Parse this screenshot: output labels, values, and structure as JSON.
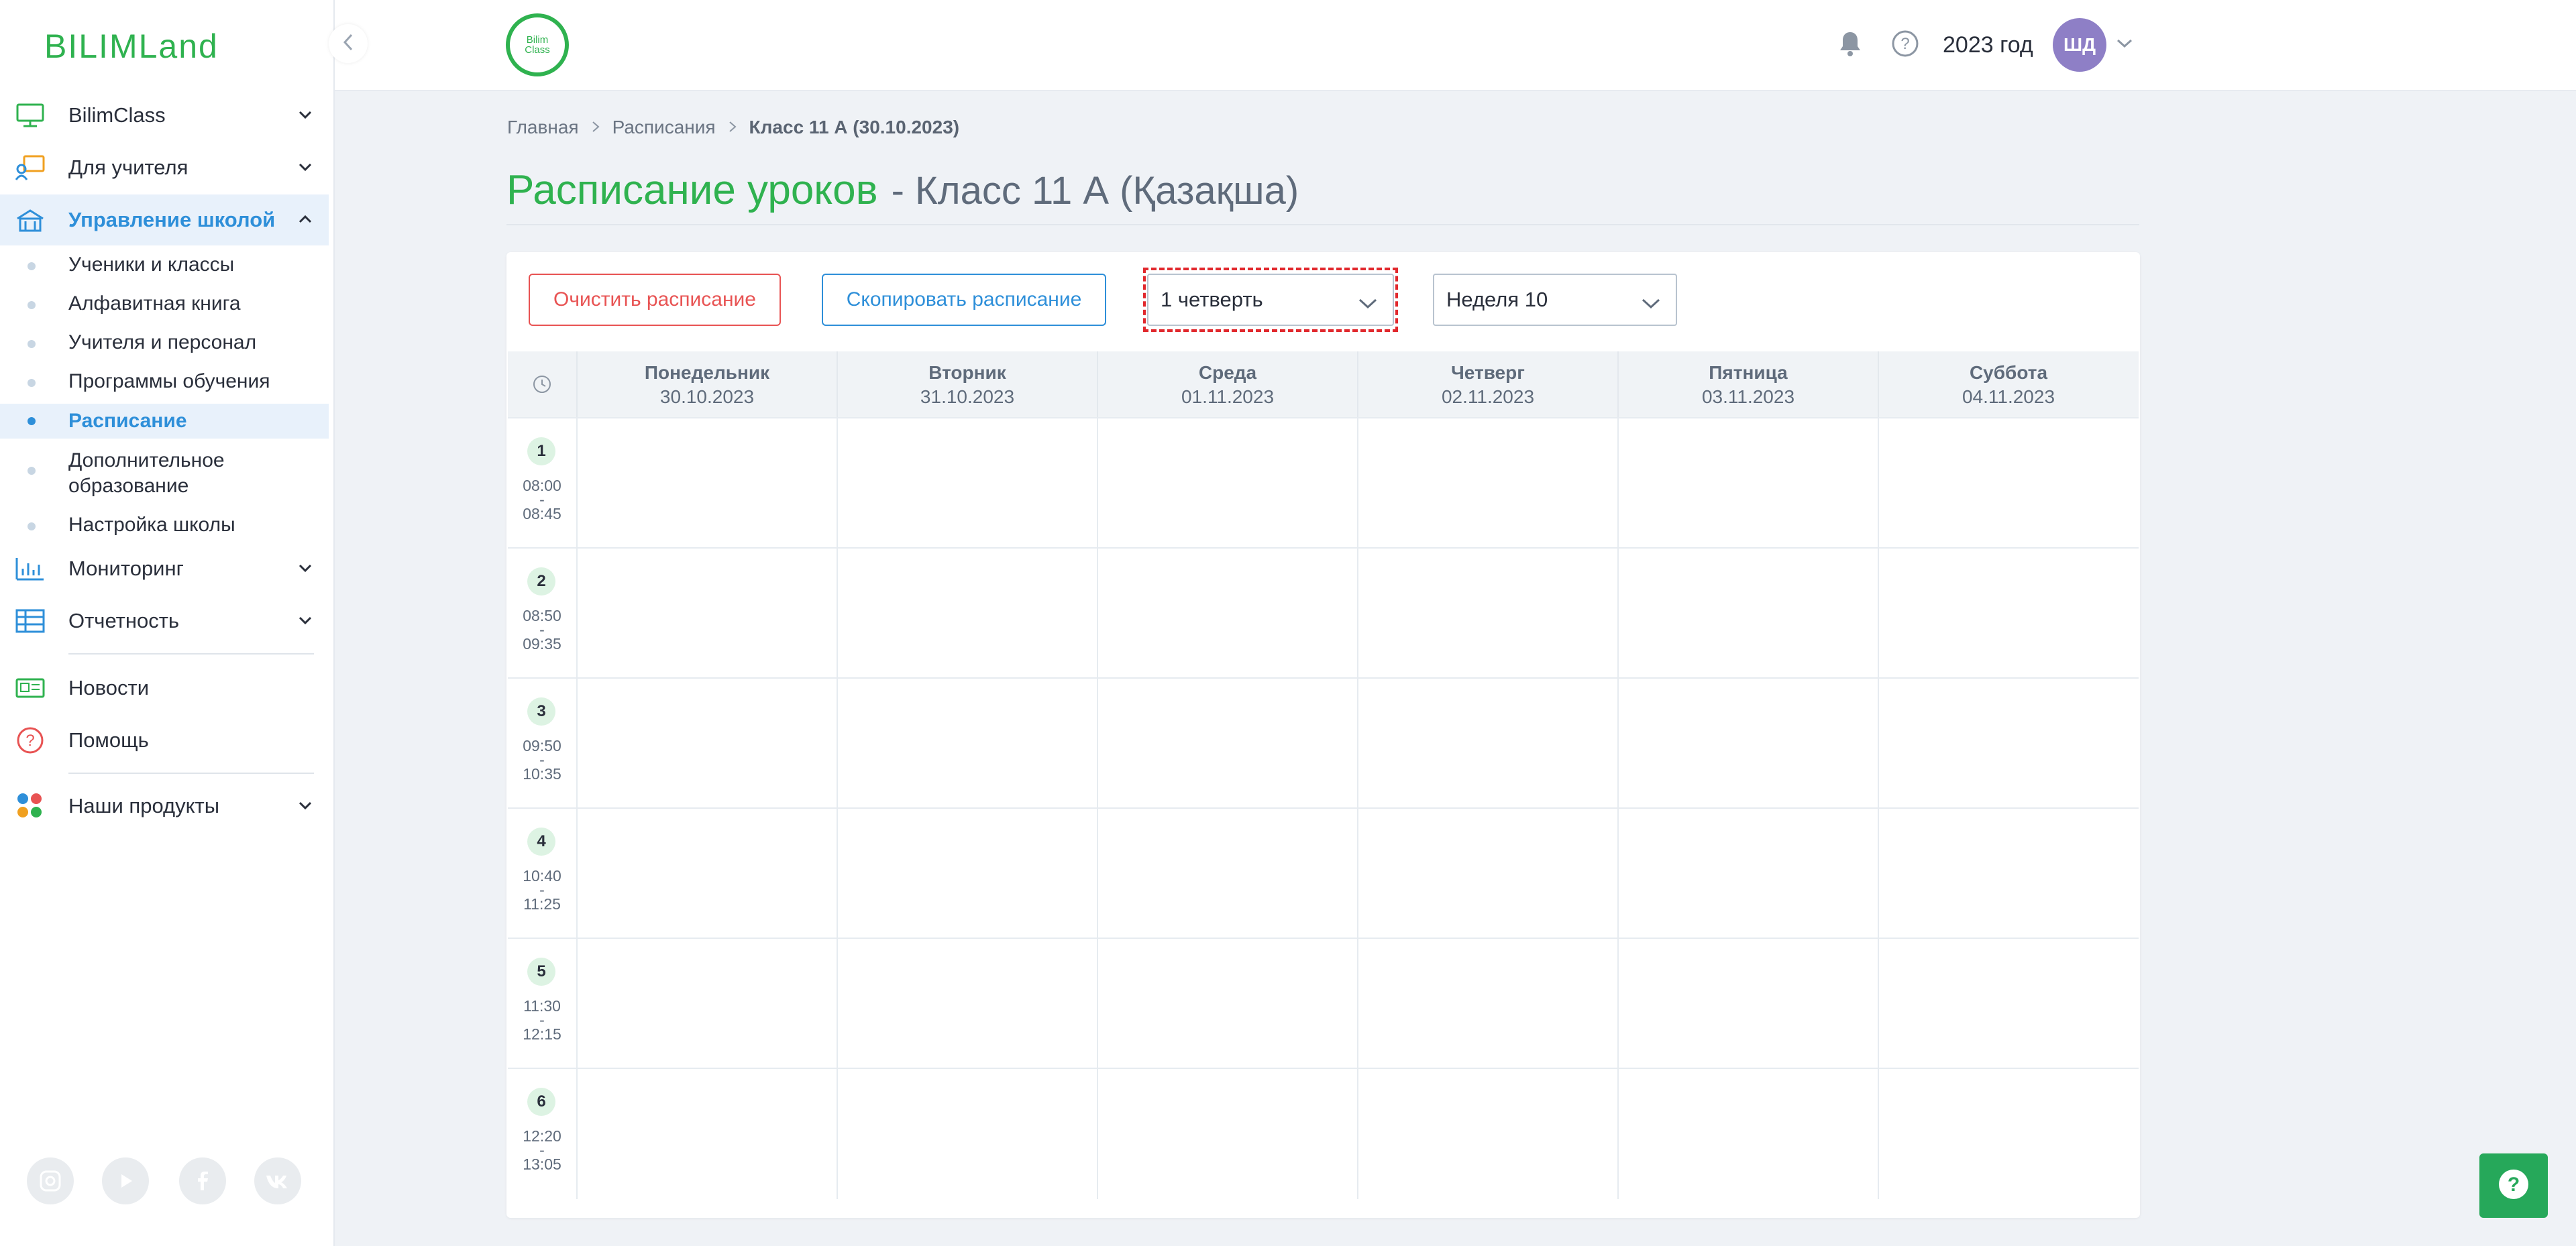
{
  "brand": {
    "logo": "BILIMLand",
    "class_logo_line1": "Bilim",
    "class_logo_line2": "Class"
  },
  "header": {
    "year": "2023 год",
    "avatar_initials": "ШД"
  },
  "sidebar": {
    "items": [
      {
        "label": "BilimClass",
        "icon": "monitor-icon"
      },
      {
        "label": "Для учителя",
        "icon": "teacher-icon"
      },
      {
        "label": "Управление школой",
        "icon": "school-icon"
      },
      {
        "label": "Мониторинг",
        "icon": "chart-icon"
      },
      {
        "label": "Отчетность",
        "icon": "table-icon"
      },
      {
        "label": "Новости",
        "icon": "news-icon"
      },
      {
        "label": "Помощь",
        "icon": "help-circle-icon"
      },
      {
        "label": "Наши продукты",
        "icon": "products-icon"
      }
    ],
    "submenu": [
      "Ученики и классы",
      "Алфавитная книга",
      "Учителя и персонал",
      "Программы обучения",
      "Расписание",
      "Дополнительное образование",
      "Настройка школы"
    ],
    "active_item": "Управление школой",
    "active_subitem": "Расписание",
    "social": [
      "instagram-icon",
      "youtube-icon",
      "facebook-icon",
      "vk-icon"
    ]
  },
  "breadcrumb": {
    "home": "Главная",
    "schedules": "Расписания",
    "current": "Класс 11 А (30.10.2023)"
  },
  "page": {
    "title": "Расписание уроков",
    "subtitle": "- Класс 11 А (Қазақша)"
  },
  "toolbar": {
    "clear_label": "Очистить расписание",
    "copy_label": "Скопировать расписание",
    "quarter_value": "1 четверть",
    "week_value": "Неделя 10"
  },
  "schedule": {
    "days": [
      {
        "name": "Понедельник",
        "date": "30.10.2023"
      },
      {
        "name": "Вторник",
        "date": "31.10.2023"
      },
      {
        "name": "Среда",
        "date": "01.11.2023"
      },
      {
        "name": "Четверг",
        "date": "02.11.2023"
      },
      {
        "name": "Пятница",
        "date": "03.11.2023"
      },
      {
        "name": "Суббота",
        "date": "04.11.2023"
      }
    ],
    "lessons": [
      {
        "num": "1",
        "start": "08:00",
        "end": "08:45"
      },
      {
        "num": "2",
        "start": "08:50",
        "end": "09:35"
      },
      {
        "num": "3",
        "start": "09:50",
        "end": "10:35"
      },
      {
        "num": "4",
        "start": "10:40",
        "end": "11:25"
      },
      {
        "num": "5",
        "start": "11:30",
        "end": "12:15"
      },
      {
        "num": "6",
        "start": "12:20",
        "end": "13:05"
      }
    ]
  },
  "colors": {
    "brand_green": "#2fb24f",
    "accent_blue": "#2e8fd9",
    "danger_red": "#e85353"
  }
}
